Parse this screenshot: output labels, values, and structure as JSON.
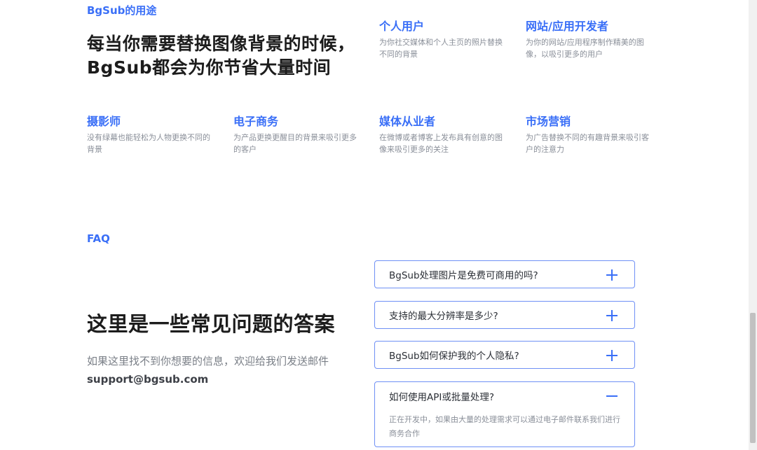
{
  "uses": {
    "eyebrow": "BgSub的用途",
    "headline_line1": "每当你需要替换图像背景的时候，",
    "headline_line2": "BgSub都会为你节省大量时间",
    "items": [
      {
        "title": "个人用户",
        "desc": "为你社交媒体和个人主页的照片替换不同的背景"
      },
      {
        "title": "网站/应用开发者",
        "desc": "为你的网站/应用程序制作精美的图像，以吸引更多的用户"
      },
      {
        "title": "摄影师",
        "desc": "没有绿幕也能轻松为人物更换不同的背景"
      },
      {
        "title": "电子商务",
        "desc": "为产品更换更醒目的背景来吸引更多的客户"
      },
      {
        "title": "媒体从业者",
        "desc": "在微博或者博客上发布具有创意的图像来吸引更多的关注"
      },
      {
        "title": "市场营销",
        "desc": "为广告替换不同的有趣背景来吸引客户的注意力"
      }
    ]
  },
  "faq": {
    "eyebrow": "FAQ",
    "headline": "这里是一些常见问题的答案",
    "subtext": "如果这里找不到你想要的信息，欢迎给我们发送邮件",
    "email": "support@bgsub.com",
    "items": [
      {
        "question": "BgSub处理图片是免费可商用的吗?",
        "expanded": false
      },
      {
        "question": "支持的最大分辨率是多少?",
        "expanded": false
      },
      {
        "question": "BgSub如何保护我的个人隐私?",
        "expanded": false
      },
      {
        "question": "如何使用API或批量处理?",
        "expanded": true,
        "answer": "正在开发中，如果由大量的处理需求可以通过电子邮件联系我们进行商务合作"
      }
    ]
  },
  "colors": {
    "accent": "#3a6ff7",
    "border": "#6f90f5",
    "muted_text": "#8a8f99",
    "heading_text": "#1c1c1c"
  }
}
